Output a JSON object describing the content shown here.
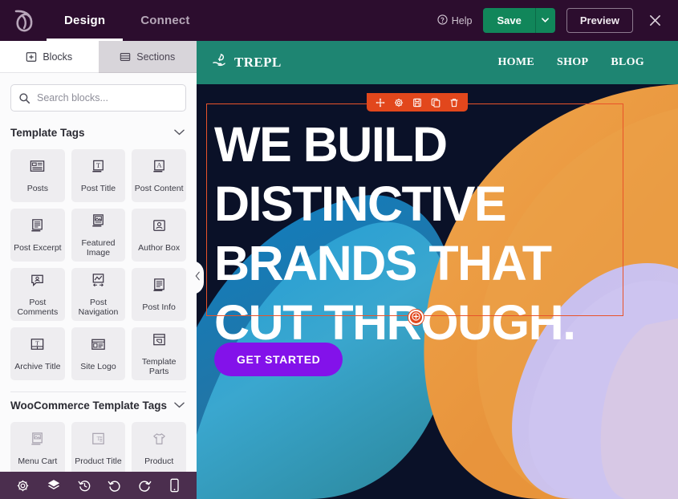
{
  "topbar": {
    "logo_icon": "leaf-logo-icon",
    "tabs": [
      {
        "label": "Design",
        "active": true
      },
      {
        "label": "Connect",
        "active": false
      }
    ],
    "help_label": "Help",
    "help_icon": "question-circle-icon",
    "save_label": "Save",
    "save_caret_icon": "chevron-down-icon",
    "preview_label": "Preview",
    "close_icon": "close-icon",
    "colors": {
      "bar_bg": "#2c0d2e",
      "save_bg": "#11865a"
    }
  },
  "left_panel": {
    "tabs": [
      {
        "label": "Blocks",
        "icon": "blocks-icon",
        "active": true
      },
      {
        "label": "Sections",
        "icon": "sections-icon",
        "active": false
      }
    ],
    "search": {
      "placeholder": "Search blocks...",
      "value": "",
      "icon": "search-icon"
    },
    "sections": [
      {
        "title": "Template Tags",
        "chevron_icon": "chevron-down-icon",
        "blocks": [
          {
            "label": "Posts",
            "icon": "posts-icon"
          },
          {
            "label": "Post Title",
            "icon": "post-title-icon"
          },
          {
            "label": "Post Content",
            "icon": "post-content-icon"
          },
          {
            "label": "Post Excerpt",
            "icon": "post-excerpt-icon"
          },
          {
            "label": "Featured Image",
            "icon": "featured-image-icon"
          },
          {
            "label": "Author Box",
            "icon": "author-box-icon"
          },
          {
            "label": "Post Comments",
            "icon": "post-comments-icon"
          },
          {
            "label": "Post Navigation",
            "icon": "post-navigation-icon"
          },
          {
            "label": "Post Info",
            "icon": "post-info-icon"
          },
          {
            "label": "Archive Title",
            "icon": "archive-title-icon"
          },
          {
            "label": "Site Logo",
            "icon": "site-logo-icon"
          },
          {
            "label": "Template Parts",
            "icon": "template-parts-icon"
          }
        ]
      },
      {
        "title": "WooCommerce Template Tags",
        "chevron_icon": "chevron-down-icon",
        "blocks": [
          {
            "label": "Menu Cart",
            "icon": "menu-cart-icon"
          },
          {
            "label": "Product Title",
            "icon": "product-title-icon"
          },
          {
            "label": "Product",
            "icon": "product-icon"
          }
        ]
      }
    ],
    "collapse_icon": "chevron-left-icon"
  },
  "bottom_toolbar": {
    "items": [
      {
        "icon": "settings-gear-icon",
        "name": "settings"
      },
      {
        "icon": "layers-icon",
        "name": "navigator"
      },
      {
        "icon": "history-icon",
        "name": "history"
      },
      {
        "icon": "undo-icon",
        "name": "undo"
      },
      {
        "icon": "redo-icon",
        "name": "redo"
      },
      {
        "icon": "responsive-mobile-icon",
        "name": "responsive-mode"
      }
    ],
    "bg": "#4b2e4e"
  },
  "preview": {
    "site_header": {
      "logo_icon": "hand-plant-icon",
      "logo_text": "TREPL",
      "bg": "#1e8572",
      "nav": [
        {
          "label": "HOME"
        },
        {
          "label": "SHOP"
        },
        {
          "label": "BLOG"
        }
      ]
    },
    "hero": {
      "heading": "WE BUILD DISTINCTIVE BRANDS THAT CUT THROUGH.",
      "cta_label": "GET STARTED",
      "cta_color": "#8312ea",
      "background_color": "#0a1128"
    },
    "block_toolbar": {
      "accent": "#e2471c",
      "items": [
        {
          "icon": "drag-move-icon",
          "name": "drag-handle"
        },
        {
          "icon": "gear-icon",
          "name": "block-settings"
        },
        {
          "icon": "save-block-icon",
          "name": "save-block"
        },
        {
          "icon": "duplicate-icon",
          "name": "duplicate-block"
        },
        {
          "icon": "trash-icon",
          "name": "delete-block"
        }
      ]
    },
    "add_block_button": {
      "icon": "plus-circle-icon"
    }
  }
}
